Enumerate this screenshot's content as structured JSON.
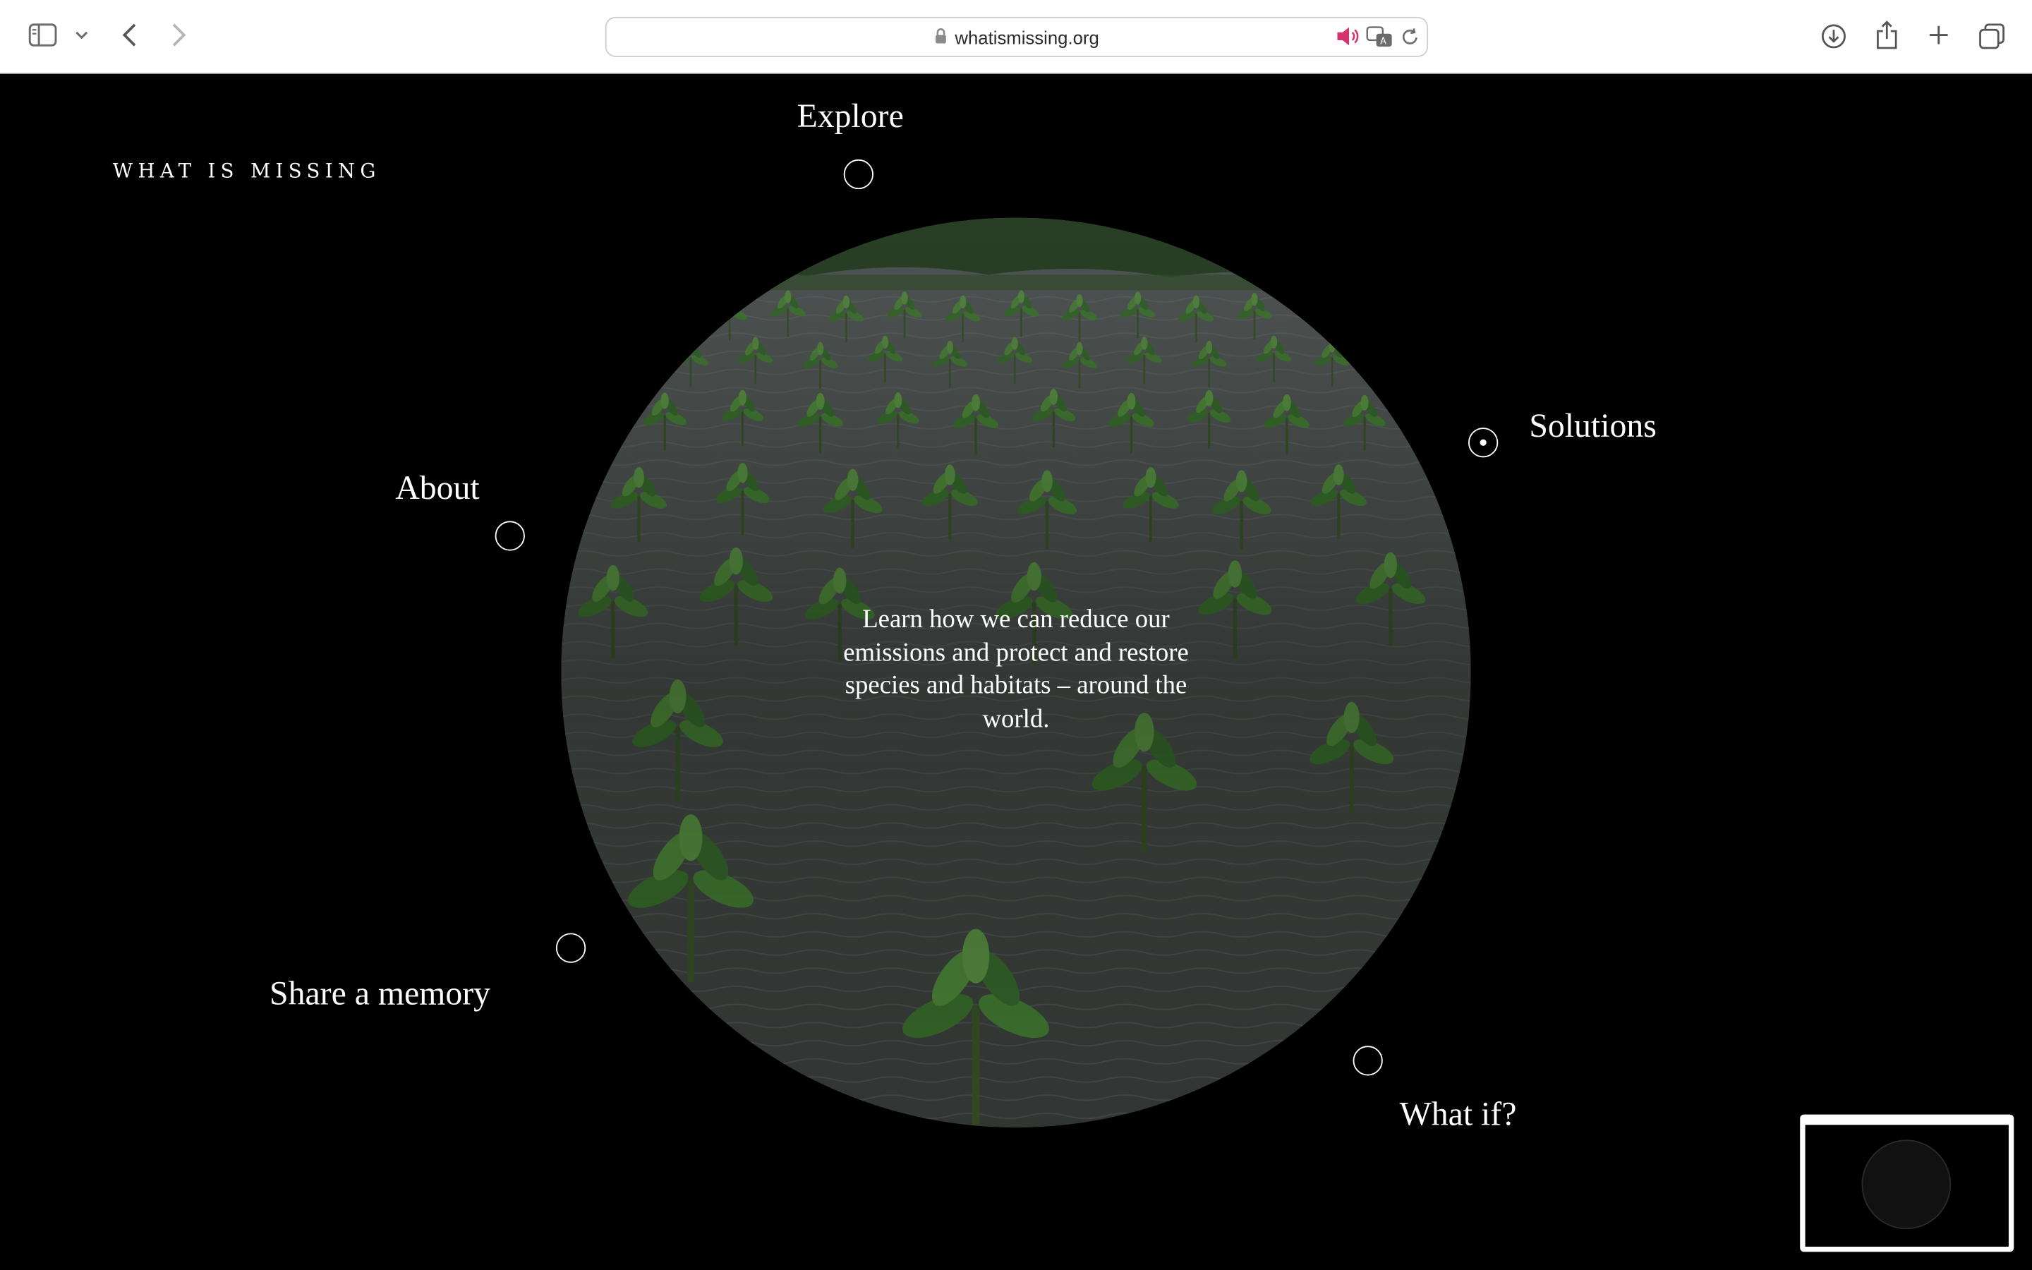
{
  "browser": {
    "url": "whatismissing.org",
    "icons": [
      "sidebar-icon",
      "chevron-down-icon",
      "back-icon",
      "forward-icon",
      "lock-icon",
      "speaker-icon",
      "translate-icon",
      "reload-icon",
      "download-icon",
      "share-icon",
      "new-tab-icon",
      "tabs-overview-icon"
    ]
  },
  "site": {
    "brand": "WHAT IS MISSING",
    "tagline": "Learn how we can reduce our emissions and protect and restore species and habitats – around the world.",
    "nav": {
      "explore": "Explore",
      "solutions": "Solutions",
      "about": "About",
      "share": "Share a memory",
      "whatif": "What if?"
    },
    "active_nav": "solutions"
  },
  "colors": {
    "page_bg": "#000000",
    "text": "#ffffff",
    "speaker_accent": "#d6336c"
  }
}
